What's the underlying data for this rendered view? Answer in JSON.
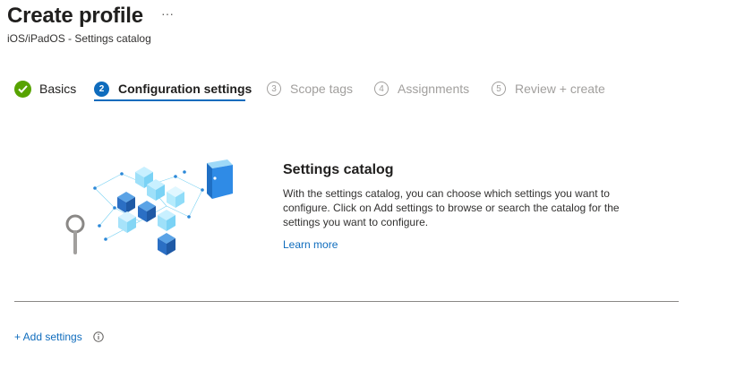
{
  "header": {
    "title": "Create profile",
    "more_label": "···",
    "subtitle": "iOS/iPadOS - Settings catalog"
  },
  "steps": [
    {
      "number": "✓",
      "label": "Basics",
      "state": "done"
    },
    {
      "number": "2",
      "label": "Configuration settings",
      "state": "current"
    },
    {
      "number": "3",
      "label": "Scope tags",
      "state": "future"
    },
    {
      "number": "4",
      "label": "Assignments",
      "state": "future"
    },
    {
      "number": "5",
      "label": "Review + create",
      "state": "future"
    }
  ],
  "catalog": {
    "title": "Settings catalog",
    "description": "With the settings catalog, you can choose which settings you want to configure. Click on Add settings to browse or search the catalog for the settings you want to configure.",
    "learn_more": "Learn more",
    "illustration_icon": "settings-catalog-cubes-illustration"
  },
  "actions": {
    "add_settings": "+ Add settings",
    "info_icon": "info-icon"
  },
  "colors": {
    "accent": "#0f6cbd",
    "success": "#57a300",
    "disabled": "#a19f9d"
  }
}
